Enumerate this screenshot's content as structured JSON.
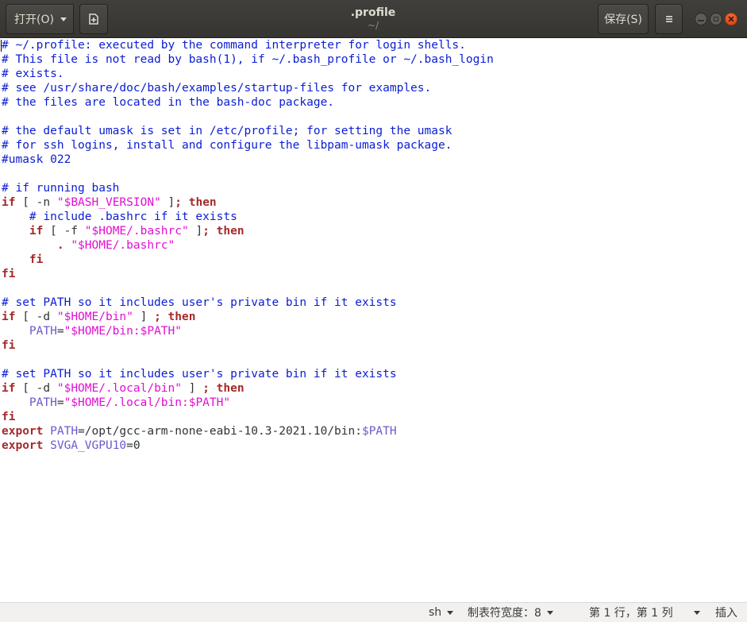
{
  "header": {
    "open_label": "打开(O)",
    "title": ".profile",
    "subtitle": "~/",
    "save_label": "保存(S)"
  },
  "editor": {
    "lines": [
      [
        {
          "t": "c",
          "s": "# ~/.profile: executed by the command interpreter for login shells."
        }
      ],
      [
        {
          "t": "c",
          "s": "# This file is not read by bash(1), if ~/.bash_profile or ~/.bash_login"
        }
      ],
      [
        {
          "t": "c",
          "s": "# exists."
        }
      ],
      [
        {
          "t": "c",
          "s": "# see /usr/share/doc/bash/examples/startup-files for examples."
        }
      ],
      [
        {
          "t": "c",
          "s": "# the files are located in the bash-doc package."
        }
      ],
      [],
      [
        {
          "t": "c",
          "s": "# the default umask is set in /etc/profile; for setting the umask"
        }
      ],
      [
        {
          "t": "c",
          "s": "# for ssh logins, install and configure the libpam-umask package."
        }
      ],
      [
        {
          "t": "c",
          "s": "#umask 022"
        }
      ],
      [],
      [
        {
          "t": "c",
          "s": "# if running bash"
        }
      ],
      [
        {
          "t": "k",
          "s": "if"
        },
        {
          "t": "t",
          "s": " [ -n "
        },
        {
          "t": "s",
          "s": "\"$BASH_VERSION\""
        },
        {
          "t": "t",
          "s": " ]"
        },
        {
          "t": "k",
          "s": "; then"
        }
      ],
      [
        {
          "t": "t",
          "s": "    "
        },
        {
          "t": "c",
          "s": "# include .bashrc if it exists"
        }
      ],
      [
        {
          "t": "t",
          "s": "    "
        },
        {
          "t": "k",
          "s": "if"
        },
        {
          "t": "t",
          "s": " [ -f "
        },
        {
          "t": "s",
          "s": "\"$HOME/.bashrc\""
        },
        {
          "t": "t",
          "s": " ]"
        },
        {
          "t": "k",
          "s": "; then"
        }
      ],
      [
        {
          "t": "t",
          "s": "        "
        },
        {
          "t": "k",
          "s": "."
        },
        {
          "t": "t",
          "s": " "
        },
        {
          "t": "s",
          "s": "\"$HOME/.bashrc\""
        }
      ],
      [
        {
          "t": "t",
          "s": "    "
        },
        {
          "t": "k",
          "s": "fi"
        }
      ],
      [
        {
          "t": "k",
          "s": "fi"
        }
      ],
      [],
      [
        {
          "t": "c",
          "s": "# set PATH so it includes user's private bin if it exists"
        }
      ],
      [
        {
          "t": "k",
          "s": "if"
        },
        {
          "t": "t",
          "s": " [ -d "
        },
        {
          "t": "s",
          "s": "\"$HOME/bin\""
        },
        {
          "t": "t",
          "s": " ] "
        },
        {
          "t": "k",
          "s": "; then"
        }
      ],
      [
        {
          "t": "t",
          "s": "    "
        },
        {
          "t": "v",
          "s": "PATH"
        },
        {
          "t": "t",
          "s": "="
        },
        {
          "t": "s",
          "s": "\"$HOME/bin:$PATH\""
        }
      ],
      [
        {
          "t": "k",
          "s": "fi"
        }
      ],
      [],
      [
        {
          "t": "c",
          "s": "# set PATH so it includes user's private bin if it exists"
        }
      ],
      [
        {
          "t": "k",
          "s": "if"
        },
        {
          "t": "t",
          "s": " [ -d "
        },
        {
          "t": "s",
          "s": "\"$HOME/.local/bin\""
        },
        {
          "t": "t",
          "s": " ] "
        },
        {
          "t": "k",
          "s": "; then"
        }
      ],
      [
        {
          "t": "t",
          "s": "    "
        },
        {
          "t": "v",
          "s": "PATH"
        },
        {
          "t": "t",
          "s": "="
        },
        {
          "t": "s",
          "s": "\"$HOME/.local/bin:$PATH\""
        }
      ],
      [
        {
          "t": "k",
          "s": "fi"
        }
      ],
      [
        {
          "t": "k",
          "s": "export"
        },
        {
          "t": "t",
          "s": " "
        },
        {
          "t": "v",
          "s": "PATH"
        },
        {
          "t": "t",
          "s": "=/opt/gcc-arm-none-eabi-10.3-2021.10/bin:"
        },
        {
          "t": "v",
          "s": "$PATH"
        }
      ],
      [
        {
          "t": "k",
          "s": "export"
        },
        {
          "t": "t",
          "s": " "
        },
        {
          "t": "v",
          "s": "SVGA_VGPU10"
        },
        {
          "t": "t",
          "s": "=0"
        }
      ]
    ]
  },
  "statusbar": {
    "language": "sh",
    "tab_width": "制表符宽度：8",
    "position": "第 1 行，第 1 列",
    "insert_mode": "插入"
  },
  "colors": {
    "comment": "#0a1dd4",
    "keyword": "#a52a2a",
    "string": "#e00fd2",
    "variable": "#6a5acd",
    "close_button": "#e95420"
  },
  "icons": {
    "new_document": "new-document-icon",
    "menu": "hamburger-menu-icon",
    "minimize": "minimize-icon",
    "maximize": "maximize-icon",
    "close": "close-icon"
  }
}
